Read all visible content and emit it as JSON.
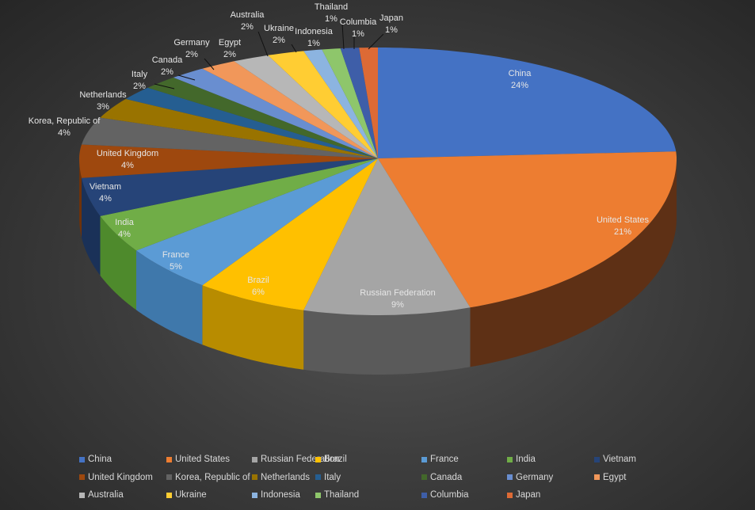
{
  "chart_data": {
    "type": "pie",
    "variant": "3d",
    "title": "",
    "legend_position": "bottom",
    "slices": [
      {
        "label": "China",
        "value": 24,
        "pct_label": "24%",
        "color": "#4472c4",
        "side": "#2f5597"
      },
      {
        "label": "United States",
        "value": 21,
        "pct_label": "21%",
        "color": "#ed7d31",
        "side": "#5e3015"
      },
      {
        "label": "Russian Federation",
        "value": 9,
        "pct_label": "9%",
        "color": "#a5a5a5",
        "side": "#5a5a5a"
      },
      {
        "label": "Brazil",
        "value": 6,
        "pct_label": "6%",
        "color": "#ffc000",
        "side": "#b88c00"
      },
      {
        "label": "France",
        "value": 5,
        "pct_label": "5%",
        "color": "#5b9bd5",
        "side": "#3f78ab"
      },
      {
        "label": "India",
        "value": 4,
        "pct_label": "4%",
        "color": "#70ad47",
        "side": "#4e8a2c"
      },
      {
        "label": "Vietnam",
        "value": 4,
        "pct_label": "4%",
        "color": "#264478",
        "side": "#1a3158"
      },
      {
        "label": "United Kingdom",
        "value": 4,
        "pct_label": "4%",
        "color": "#9e480e",
        "side": "#6e320a"
      },
      {
        "label": "Korea, Republic of",
        "value": 4,
        "pct_label": "4%",
        "color": "#636363",
        "side": "#444444"
      },
      {
        "label": "Netherlands",
        "value": 3,
        "pct_label": "3%",
        "color": "#997300",
        "side": "#6b5000"
      },
      {
        "label": "Italy",
        "value": 2,
        "pct_label": "2%",
        "color": "#255e91",
        "side": "#1a4266"
      },
      {
        "label": "Canada",
        "value": 2,
        "pct_label": "2%",
        "color": "#43682b",
        "side": "#2f491e"
      },
      {
        "label": "Germany",
        "value": 2,
        "pct_label": "2%",
        "color": "#698ed0",
        "side": "#4a6aa5"
      },
      {
        "label": "Egypt",
        "value": 2,
        "pct_label": "2%",
        "color": "#f1975a",
        "side": "#b06a3c"
      },
      {
        "label": "Australia",
        "value": 2,
        "pct_label": "2%",
        "color": "#b7b7b7",
        "side": "#808080"
      },
      {
        "label": "Ukraine",
        "value": 2,
        "pct_label": "2%",
        "color": "#ffcd33",
        "side": "#b8931f"
      },
      {
        "label": "Indonesia",
        "value": 1,
        "pct_label": "1%",
        "color": "#8cb4e0",
        "side": "#5f86b0"
      },
      {
        "label": "Thailand",
        "value": 1,
        "pct_label": "1%",
        "color": "#8ec66b",
        "side": "#5f8e44"
      },
      {
        "label": "Columbia",
        "value": 1,
        "pct_label": "1%",
        "color": "#3e5ea8",
        "side": "#2a4279"
      },
      {
        "label": "Japan",
        "value": 1,
        "pct_label": "1%",
        "color": "#dd6a35",
        "side": "#9c4a22"
      }
    ]
  }
}
